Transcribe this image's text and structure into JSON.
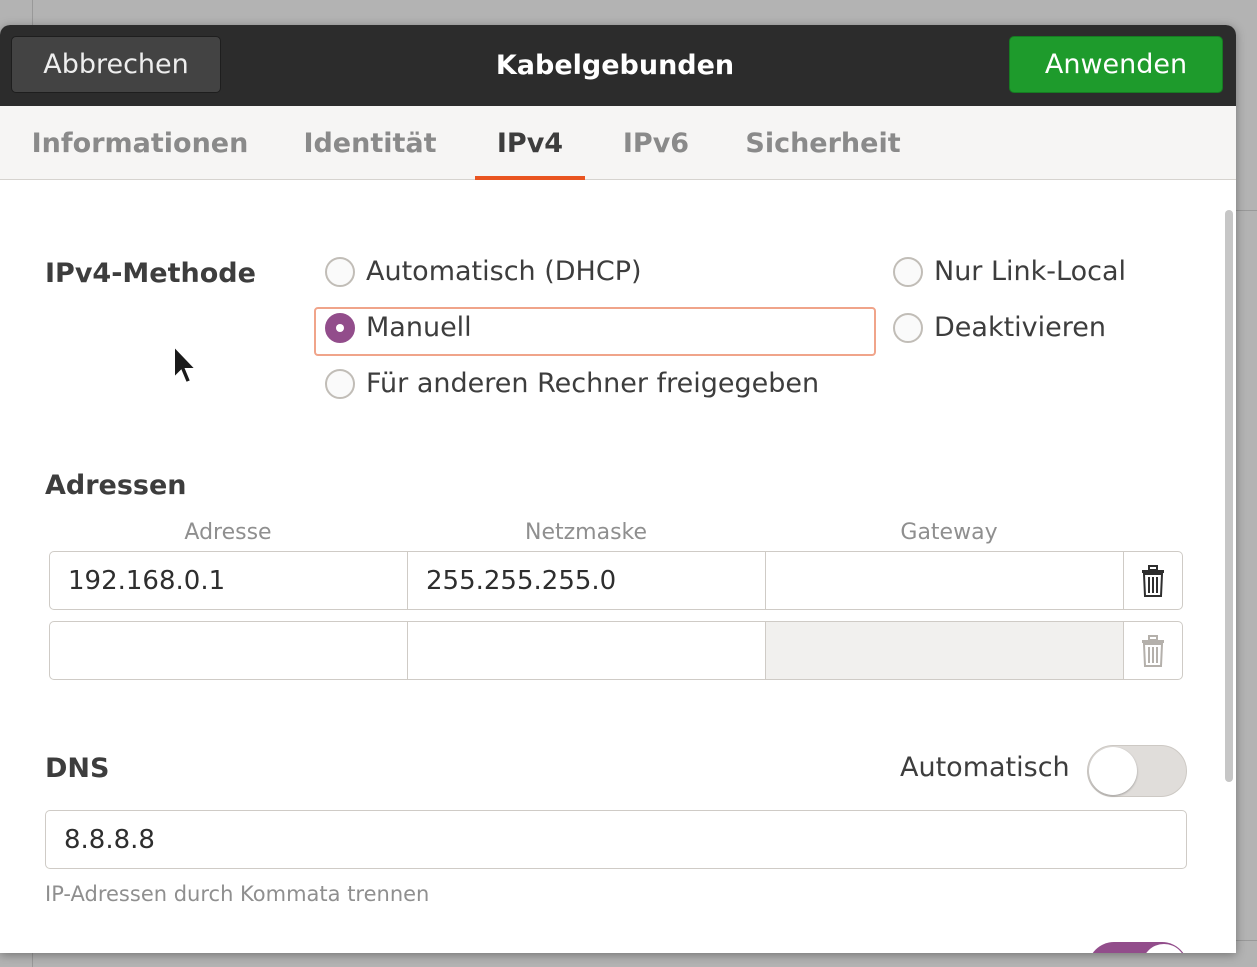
{
  "header": {
    "cancel_label": "Abbrechen",
    "title": "Kabelgebunden",
    "apply_label": "Anwenden"
  },
  "tabs": [
    {
      "label": "Informationen",
      "active": false
    },
    {
      "label": "Identität",
      "active": false
    },
    {
      "label": "IPv4",
      "active": true
    },
    {
      "label": "IPv6",
      "active": false
    },
    {
      "label": "Sicherheit",
      "active": false
    }
  ],
  "method": {
    "label": "IPv4-Methode",
    "options": [
      {
        "label": "Automatisch (DHCP)",
        "checked": false
      },
      {
        "label": "Manuell",
        "checked": true
      },
      {
        "label": "Für anderen Rechner freigegeben",
        "checked": false
      },
      {
        "label": "Nur Link-Local",
        "checked": false
      },
      {
        "label": "Deaktivieren",
        "checked": false
      }
    ]
  },
  "addresses": {
    "label": "Adressen",
    "columns": [
      "Adresse",
      "Netzmaske",
      "Gateway"
    ],
    "rows": [
      {
        "address": "192.168.0.1",
        "netmask": "255.255.255.0",
        "gateway": ""
      },
      {
        "address": "",
        "netmask": "",
        "gateway": ""
      }
    ]
  },
  "dns": {
    "label": "DNS",
    "auto_label": "Automatisch",
    "auto_enabled": false,
    "value": "8.8.8.8",
    "hint": "IP-Adressen durch Kommata trennen"
  },
  "colors": {
    "accent": "#e95420",
    "apply": "#1e9b2c",
    "radio_checked": "#924d8b",
    "headerbar": "#2c2c2c"
  }
}
